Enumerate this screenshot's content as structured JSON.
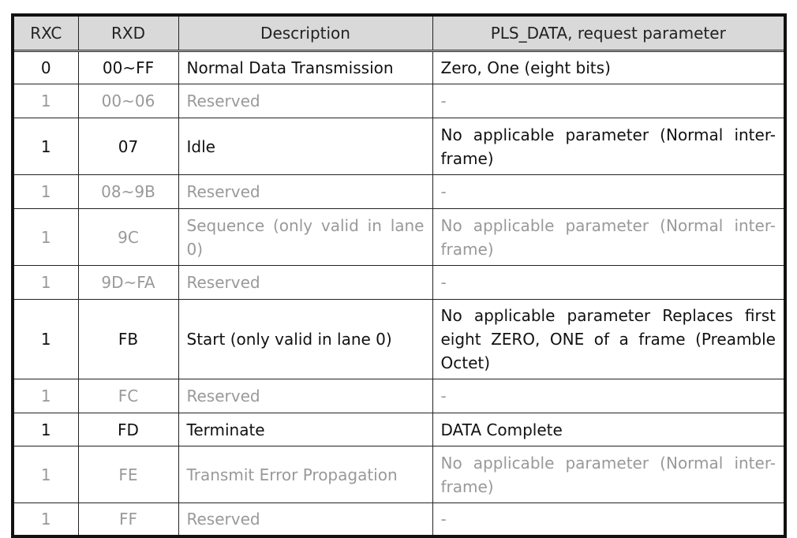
{
  "table": {
    "headers": [
      "RXC",
      "RXD",
      "Description",
      "PLS_DATA, request parameter"
    ],
    "rows": [
      {
        "rxc": "0",
        "rxd": "00~FF",
        "desc": "Normal Data Transmission",
        "param": "Zero, One (eight bits)",
        "muted": false,
        "h": 42
      },
      {
        "rxc": "1",
        "rxd": "00~06",
        "desc": "Reserved",
        "param": "-",
        "muted": true,
        "h": 43
      },
      {
        "rxc": "1",
        "rxd": "07",
        "desc": "Idle",
        "param": "No applicable parameter (Normal inter-frame)",
        "muted": false,
        "h": 72
      },
      {
        "rxc": "1",
        "rxd": "08~9B",
        "desc": "Reserved",
        "param": "-",
        "muted": true,
        "h": 43
      },
      {
        "rxc": "1",
        "rxd": "9C",
        "desc": "Sequence (only valid in lane 0)",
        "param": "No applicable parameter (Normal inter-frame)",
        "muted": true,
        "h": 72
      },
      {
        "rxc": "1",
        "rxd": "9D~FA",
        "desc": "Reserved",
        "param": "-",
        "muted": true,
        "h": 43
      },
      {
        "rxc": "1",
        "rxd": "FB",
        "desc": "Start (only valid in lane 0)",
        "param": "No applicable parameter Replaces first eight ZERO, ONE of a frame (Preamble Octet)",
        "muted": false,
        "h": 101
      },
      {
        "rxc": "1",
        "rxd": "FC",
        "desc": "Reserved",
        "param": "-",
        "muted": true,
        "h": 43
      },
      {
        "rxc": "1",
        "rxd": "FD",
        "desc": "Terminate",
        "param": "DATA Complete",
        "muted": false,
        "h": 42
      },
      {
        "rxc": "1",
        "rxd": "FE",
        "desc": "Transmit Error Propagation",
        "param": "No applicable parameter (Normal inter-frame)",
        "muted": true,
        "h": 72
      },
      {
        "rxc": "1",
        "rxd": "FF",
        "desc": "Reserved",
        "param": "-",
        "muted": true,
        "h": 42
      }
    ]
  }
}
